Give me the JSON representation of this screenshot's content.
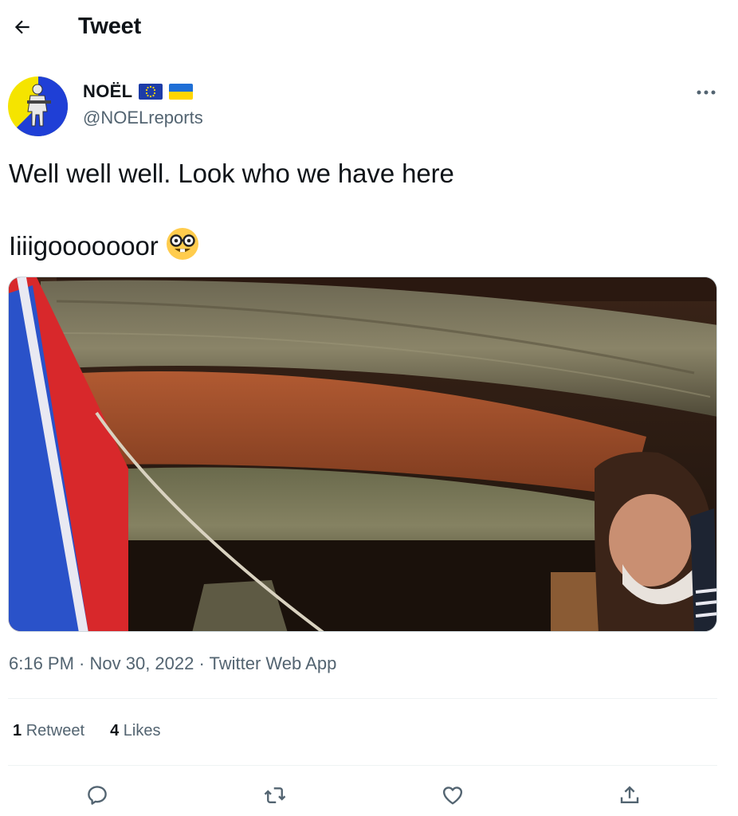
{
  "header": {
    "title": "Tweet",
    "back_icon": "arrow-left-icon"
  },
  "author": {
    "display_name": "NOËL",
    "handle": "@NOELreports",
    "flags": [
      "eu-flag-icon",
      "ukraine-flag-icon"
    ],
    "avatar_colors": [
      "#f5e400",
      "#1f3fd6"
    ]
  },
  "tweet": {
    "text": "Well well well. Look who we have here\n\nIiiigooooooor",
    "emoji": "nerd-face-emoji"
  },
  "meta": {
    "time": "6:16 PM",
    "sep1": " · ",
    "date": "Nov 30, 2022",
    "sep2": " · ",
    "source": "Twitter Web App"
  },
  "stats": {
    "retweets_count": "1",
    "retweets_label": "Retweet",
    "likes_count": "4",
    "likes_label": "Likes"
  },
  "actions": [
    "reply-icon",
    "retweet-icon",
    "like-icon",
    "share-icon"
  ],
  "colors": {
    "text": "#0f1419",
    "secondary": "#536471",
    "divider": "#eff3f4"
  }
}
